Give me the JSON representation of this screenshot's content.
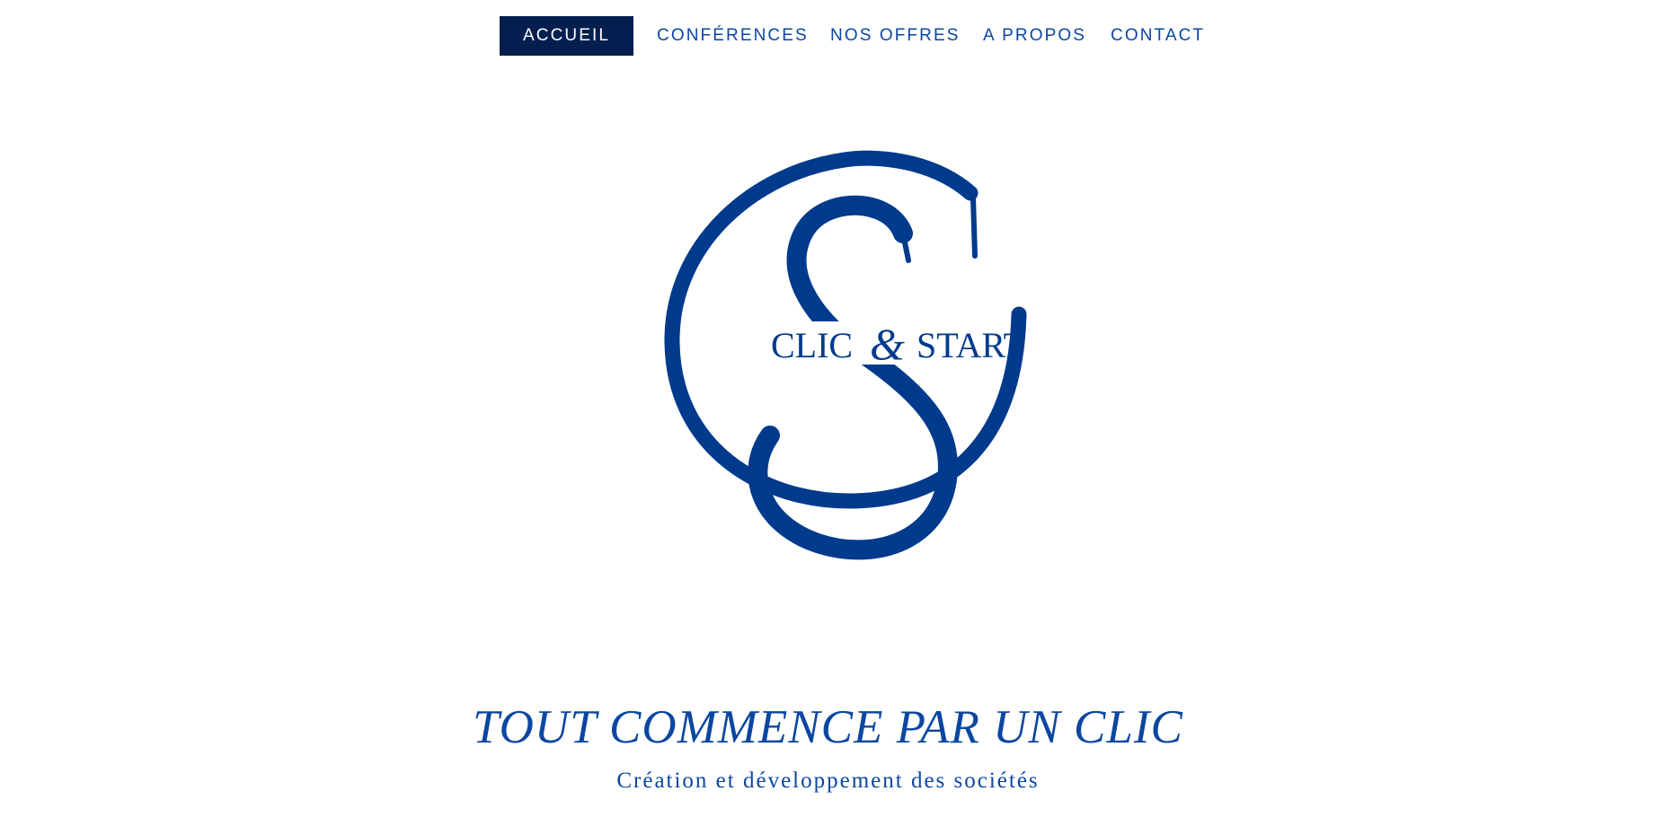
{
  "nav": {
    "items": [
      {
        "label": "ACCUEIL",
        "active": true
      },
      {
        "label": "CONFÉRENCES",
        "active": false
      },
      {
        "label": "NOS OFFRES",
        "active": false
      },
      {
        "label": "A PROPOS",
        "active": false
      },
      {
        "label": "CONTACT",
        "active": false
      }
    ]
  },
  "logo": {
    "left_text": "CLIC",
    "ampersand": "&",
    "right_text": "START",
    "color": "#003a8c"
  },
  "hero": {
    "headline": "TOUT COMMENCE PAR UN CLIC",
    "subline": "Création et développement des sociétés"
  },
  "colors": {
    "accent": "#0b47a0",
    "active_nav_bg": "#041f4f",
    "background": "#ffffff"
  }
}
